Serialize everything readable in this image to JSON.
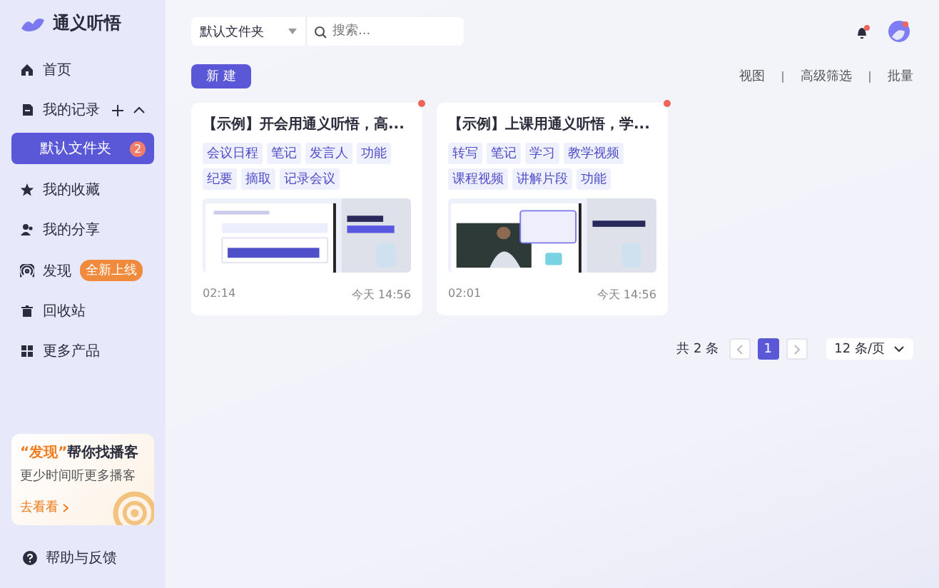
{
  "app": {
    "name": "通义听悟"
  },
  "sidebar": {
    "items": [
      {
        "label": "首页",
        "selected": false
      },
      {
        "label": "我的记录",
        "selected": false,
        "expanded": true,
        "children": [
          {
            "label": "默认文件夹",
            "selected": true,
            "count": "2"
          }
        ]
      },
      {
        "label": "我的收藏",
        "selected": false
      },
      {
        "label": "我的分享",
        "selected": false
      },
      {
        "label": "发现",
        "selected": false,
        "badge": "全新上线"
      },
      {
        "label": "回收站",
        "selected": false
      },
      {
        "label": "更多产品",
        "selected": false
      }
    ],
    "promo": {
      "title": "**“发现”**帮你找播客",
      "subtitle": "更少时间听更多播客",
      "link": "去看看"
    },
    "help": "帮助与反馈"
  },
  "toolbar": {
    "folder_select": {
      "value": "默认文件夹"
    },
    "search": {
      "placeholder": "搜索..."
    },
    "notification": true,
    "new_button": "新 建",
    "actions": [
      "视图",
      "高级筛选",
      "批量"
    ]
  },
  "cards": [
    {
      "title": "【示例】开会用通义听悟，高...",
      "tags": [
        "会议日程",
        "笔记",
        "发言人",
        "功能",
        "纪要",
        "摘取",
        "记录会议"
      ],
      "duration": "02:14",
      "time": "今天 14:56",
      "unread": true
    },
    {
      "title": "【示例】上课用通义听悟，学...",
      "tags": [
        "转写",
        "笔记",
        "学习",
        "教学视频",
        "课程视频",
        "讲解片段",
        "功能"
      ],
      "duration": "02:01",
      "time": "今天 14:56",
      "unread": true
    }
  ],
  "pagination": {
    "total": "共 2 条",
    "pages": [
      {
        "label": "1",
        "selected": true
      }
    ],
    "page_size": "12 条/页"
  }
}
